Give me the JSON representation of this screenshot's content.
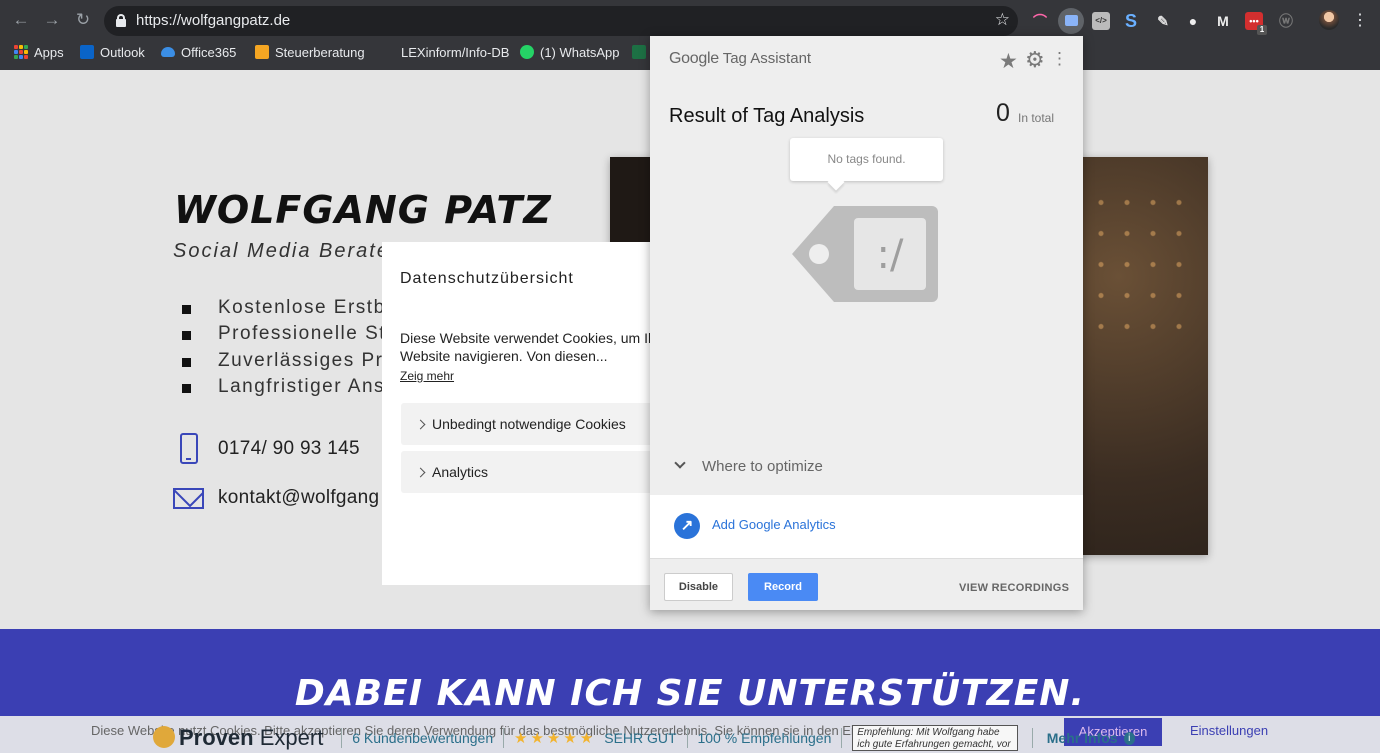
{
  "browser": {
    "url": "https://wolfgangpatz.de",
    "bookmarks": [
      {
        "label": "Apps"
      },
      {
        "label": "Outlook"
      },
      {
        "label": "Office365"
      },
      {
        "label": "Steuerberatung"
      },
      {
        "label": "LEXinform/Info-DB"
      },
      {
        "label": "(1) WhatsApp"
      }
    ],
    "extensions": [
      "rainbow-ext-icon",
      "tag-assistant-icon",
      "code-ext-icon",
      "s-ext-icon",
      "pen-ext-icon",
      "ball-ext-icon",
      "m-ext-icon",
      "red-ext-icon",
      "wordpress-icon"
    ],
    "extension_labels": {
      "s": "S",
      "m": "M",
      "red": "•••",
      "red_badge": "1",
      "code": "</>"
    }
  },
  "site": {
    "name": "WOLFGANG PATZ",
    "tagline": "Social Media Berater",
    "bullets": [
      "Kostenlose Erstbe",
      "Professionelle Str",
      "Zuverlässiges Pro",
      "Langfristiger Ansp"
    ],
    "phone": "0174/ 90 93 145",
    "email": "kontakt@wolfgang",
    "band_title": "DABEI KANN ICH SIE UNTERSTÜTZEN.",
    "cookie_bar": {
      "text": "Diese Website nutzt Cookies. Bitte akzeptieren Sie deren Verwendung für das bestmögliche Nutzererlebnis. Sie können sie in den Einstellungen anpassen.",
      "accept": "Akzeptieren",
      "settings": "Einstellungen"
    },
    "proven_expert": {
      "logo_a": "Proven",
      "logo_b": "Expert",
      "reviews": "6 Kundenbewertungen",
      "stars": "★★★★★",
      "rating": "SEHR GUT",
      "recommend": "100 % Empfehlungen",
      "quote": "Empfehlung: Mit Wolfgang habe ich gute Erfahrungen gemacht, vor alle...",
      "more": "Mehr Infos",
      "info": "i"
    }
  },
  "privacy_modal": {
    "title": "Datenschutzübersicht",
    "text": "Diese Website verwendet Cookies, um Ih Website navigieren. Von diesen...",
    "more_link": "Zeig mehr",
    "sections": [
      "Unbedingt notwendige Cookies",
      "Analytics"
    ]
  },
  "tag_assistant": {
    "logo_google": "Google",
    "logo_product": " Tag Assistant",
    "title": "Result of Tag Analysis",
    "count": "0",
    "count_label": "In total",
    "empty_message": "No tags found.",
    "tag_face": ":/",
    "where_label": "Where to optimize",
    "analytics_link": "Add Google Analytics",
    "buttons": {
      "disable": "Disable",
      "record": "Record",
      "view": "VIEW RECORDINGS"
    }
  },
  "colors": {
    "accent_blue": "#3b3fb3",
    "record_blue": "#4a8af4",
    "link_blue": "#2a73d9",
    "chrome_dark": "#35363a"
  }
}
